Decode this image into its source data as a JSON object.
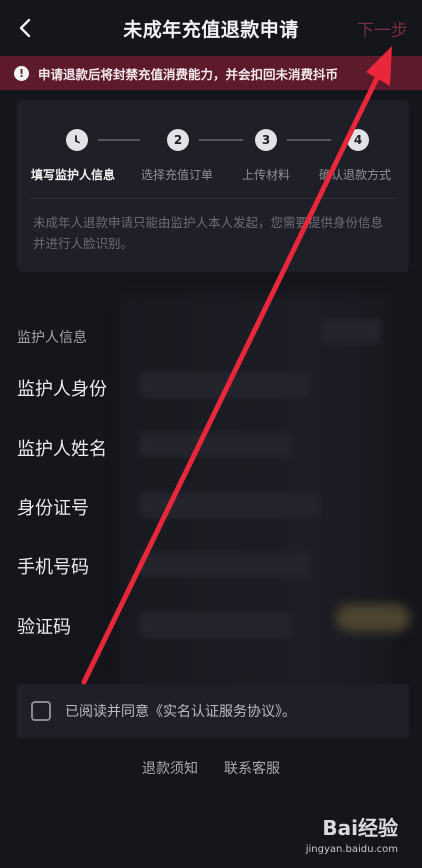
{
  "nav": {
    "title": "未成年充值退款申请",
    "next_label": "下一步"
  },
  "warning": {
    "icon": "alert-icon",
    "text": "申请退款后将封禁充值消费能力，并会扣回未消费抖币",
    "color": "#5c1a2a"
  },
  "steps": [
    {
      "num": "",
      "label": "填写监护人信息",
      "active": true
    },
    {
      "num": "2",
      "label": "选择充值订单",
      "active": false
    },
    {
      "num": "3",
      "label": "上传材料",
      "active": false
    },
    {
      "num": "4",
      "label": "确认退款方式",
      "active": false
    }
  ],
  "steps_note": "未成年人退款申请只能由监护人本人发起，您需要提供身份信息并进行人脸识别。",
  "form": {
    "section_title": "监护人信息",
    "fields": [
      {
        "label": "监护人身份"
      },
      {
        "label": "监护人姓名"
      },
      {
        "label": "身份证号"
      },
      {
        "label": "手机号码"
      },
      {
        "label": "验证码"
      }
    ]
  },
  "agreement": {
    "text": "已阅读并同意《实名认证服务协议》。"
  },
  "links": {
    "refund_notice": "退款须知",
    "contact_service": "联系客服"
  },
  "watermark": {
    "brand": "Bai经验",
    "url": "jingyan.baidu.com"
  },
  "colors": {
    "background": "#15151c",
    "card": "#1f1f27",
    "accent_red": "#e8283a"
  }
}
